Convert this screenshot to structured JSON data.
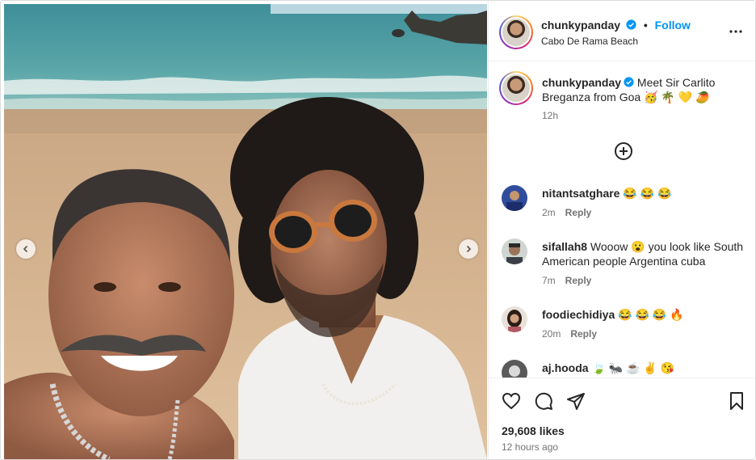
{
  "header": {
    "username": "chunkypanday",
    "separator": "•",
    "follow_label": "Follow",
    "location": "Cabo De Rama Beach"
  },
  "caption": {
    "username": "chunkypanday",
    "text": "Meet Sir Carlito Breganza from Goa 🥳 🌴 💛 🥭",
    "time": "12h"
  },
  "comments": [
    {
      "username": "nitantsatghare",
      "text": "😂 😂 😂",
      "time": "2m",
      "reply_label": "Reply"
    },
    {
      "username": "sifallah8",
      "text": "Wooow 😮 you look like South American people Argentina cuba",
      "time": "7m",
      "reply_label": "Reply"
    },
    {
      "username": "foodiechidiya",
      "text": "😂 😂 😂 🔥",
      "time": "20m",
      "reply_label": "Reply"
    },
    {
      "username": "aj.hooda",
      "text": "🍃 🐜 ☕ ✌️ 😘",
      "time": "",
      "reply_label": ""
    }
  ],
  "stats": {
    "likes": "29,608 likes",
    "posted": "12 hours ago"
  },
  "icons": {
    "verified": "verified-badge-icon",
    "more": "more-options-icon",
    "load_more": "plus-circle-icon",
    "like": "heart-icon",
    "comment": "comment-icon",
    "share": "share-icon",
    "save": "bookmark-icon"
  },
  "colors": {
    "accent": "#0095f6",
    "verified": "#0095f6",
    "muted_text": "#737373",
    "text": "#262626"
  }
}
